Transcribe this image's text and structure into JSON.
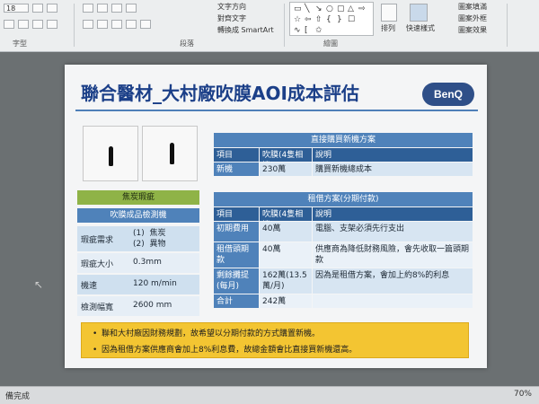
{
  "ribbon": {
    "font_size": "18",
    "font_group": "字型",
    "paragraph_group": "段落",
    "text_direction": "文字方向",
    "align_text": "對齊文字",
    "smartart": "轉換成 SmartArt",
    "drawing_group": "繪圖",
    "arrange": "排列",
    "quick_styles": "快速樣式",
    "shape_fill": "圖案填滿",
    "shape_outline": "圖案外框",
    "shape_effects": "圖案效果"
  },
  "slide": {
    "title": "聯合醫材_大村廠吹膜AOI成本評估",
    "logo": "BenQ",
    "left_table": {
      "header_green": "焦炭瑕疵",
      "header_blue": "吹膜成品檢測機",
      "rows": [
        {
          "label": "瑕疵需求",
          "value": "(1)  焦炭\n(2)  異物"
        },
        {
          "label": "瑕疵大小",
          "value": "0.3mm"
        },
        {
          "label": "機速",
          "value": "120 m/min"
        },
        {
          "label": "檢測幅寬",
          "value": "2600 mm"
        }
      ]
    },
    "buy_table": {
      "title": "直接購買新機方案",
      "header": [
        "項目",
        "吹膜(4隻相機)",
        "說明"
      ],
      "rows": [
        [
          "新機",
          "230萬",
          "購買新機總成本"
        ]
      ]
    },
    "lease_table": {
      "title": "租借方案(分期付款)",
      "header": [
        "項目",
        "吹膜(4隻相機)",
        "說明"
      ],
      "rows": [
        [
          "初期費用",
          "40萬",
          "電腦、支架必須先行支出"
        ],
        [
          "租借頭期款",
          "40萬",
          "供應商為降低財務風險，會先收取一篇頭期款"
        ],
        [
          "剩餘攤提(每月)",
          "162萬(13.5萬/月)",
          "因為是租借方案，會加上約8%的利息"
        ],
        [
          "合計",
          "242萬",
          ""
        ]
      ]
    },
    "notes": [
      "聯和大村廠因財務規劃，故希望以分期付款的方式購置新機。",
      "因為租借方案供應商會加上8%利息費，故總金額會比直接買新機還高。"
    ]
  },
  "status": {
    "left": "備完成",
    "zoom": "70%"
  }
}
